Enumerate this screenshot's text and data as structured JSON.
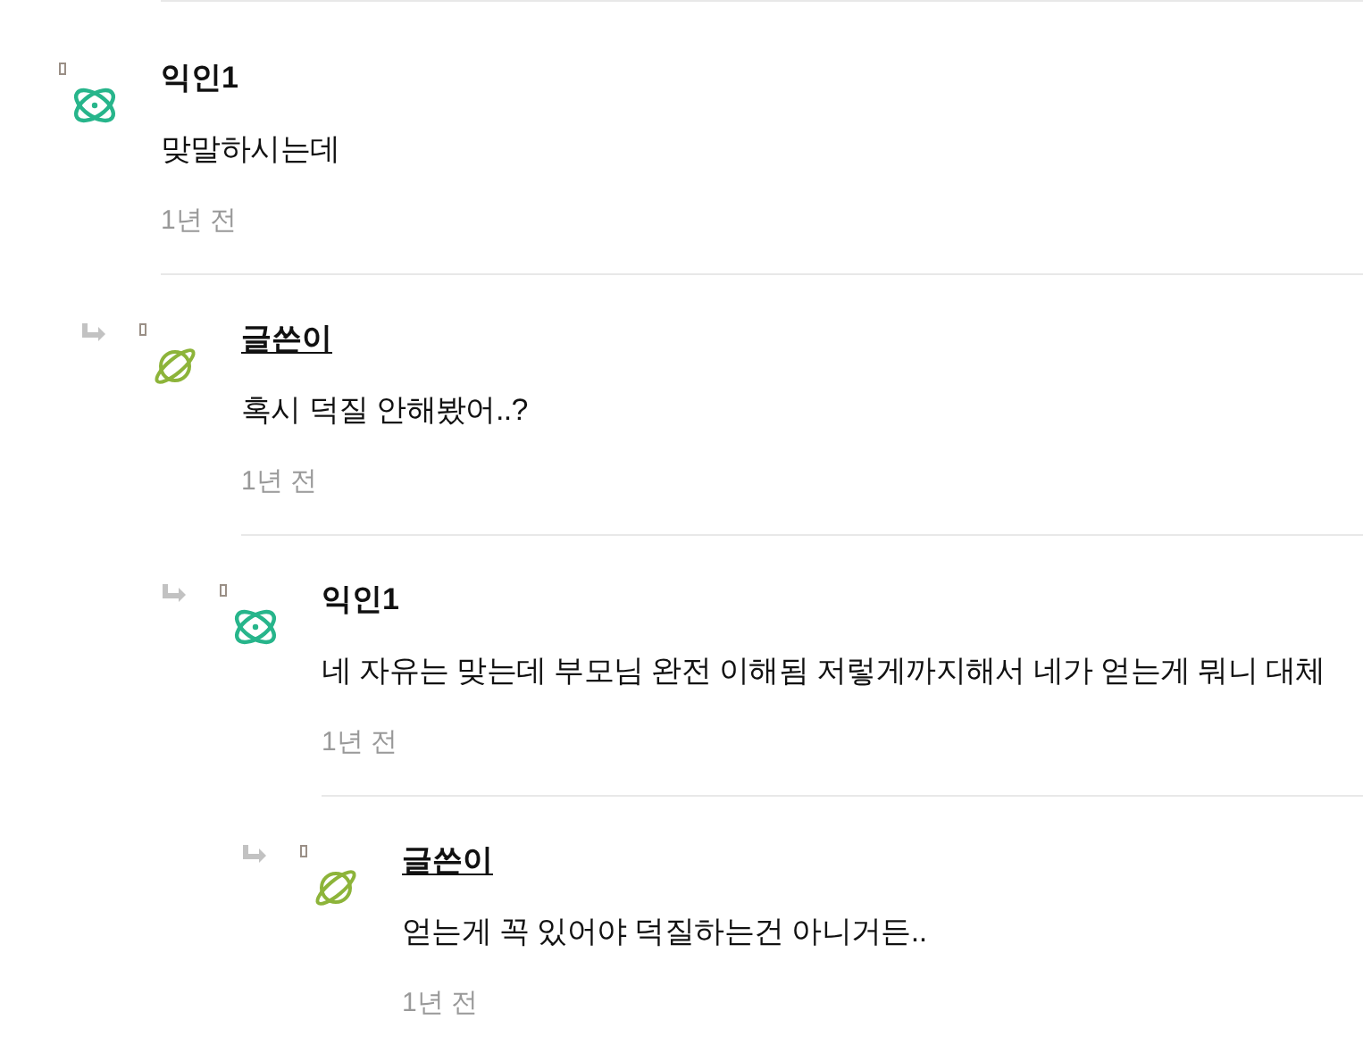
{
  "comments": [
    {
      "author": "익인1",
      "kind": "atom",
      "is_author": false,
      "body": "맞말하시는데",
      "time": "1년 전",
      "children": [
        {
          "author": "글쓴이",
          "kind": "planet",
          "is_author": true,
          "body": "혹시 덕질 안해봤어..?",
          "time": "1년 전",
          "children": [
            {
              "author": "익인1",
              "kind": "atom",
              "is_author": false,
              "body": "네 자유는 맞는데 부모님 완전 이해됨 저렇게까지해서 네가 얻는게 뭐니 대체",
              "time": "1년 전",
              "children": [
                {
                  "author": "글쓴이",
                  "kind": "planet",
                  "is_author": true,
                  "body": "얻는게 꼭 있어야 덕질하는건 아니거든..",
                  "time": "1년 전"
                }
              ]
            }
          ]
        }
      ]
    }
  ]
}
